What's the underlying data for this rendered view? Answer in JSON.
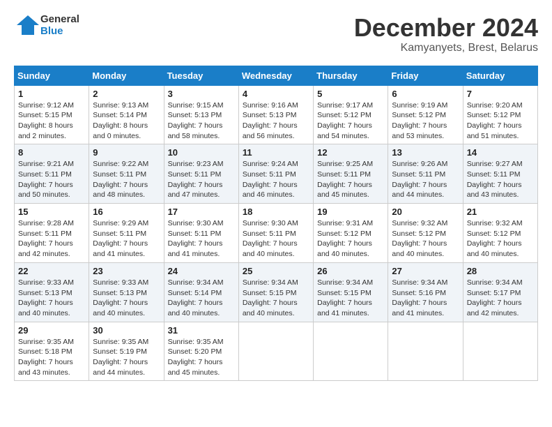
{
  "logo": {
    "text_general": "General",
    "text_blue": "Blue"
  },
  "title": {
    "month_year": "December 2024",
    "location": "Kamyanyets, Brest, Belarus"
  },
  "days_of_week": [
    "Sunday",
    "Monday",
    "Tuesday",
    "Wednesday",
    "Thursday",
    "Friday",
    "Saturday"
  ],
  "weeks": [
    [
      {
        "day": "1",
        "sunrise": "9:12 AM",
        "sunset": "5:15 PM",
        "daylight": "8 hours and 2 minutes."
      },
      {
        "day": "2",
        "sunrise": "9:13 AM",
        "sunset": "5:14 PM",
        "daylight": "8 hours and 0 minutes."
      },
      {
        "day": "3",
        "sunrise": "9:15 AM",
        "sunset": "5:13 PM",
        "daylight": "7 hours and 58 minutes."
      },
      {
        "day": "4",
        "sunrise": "9:16 AM",
        "sunset": "5:13 PM",
        "daylight": "7 hours and 56 minutes."
      },
      {
        "day": "5",
        "sunrise": "9:17 AM",
        "sunset": "5:12 PM",
        "daylight": "7 hours and 54 minutes."
      },
      {
        "day": "6",
        "sunrise": "9:19 AM",
        "sunset": "5:12 PM",
        "daylight": "7 hours and 53 minutes."
      },
      {
        "day": "7",
        "sunrise": "9:20 AM",
        "sunset": "5:12 PM",
        "daylight": "7 hours and 51 minutes."
      }
    ],
    [
      {
        "day": "8",
        "sunrise": "9:21 AM",
        "sunset": "5:11 PM",
        "daylight": "7 hours and 50 minutes."
      },
      {
        "day": "9",
        "sunrise": "9:22 AM",
        "sunset": "5:11 PM",
        "daylight": "7 hours and 48 minutes."
      },
      {
        "day": "10",
        "sunrise": "9:23 AM",
        "sunset": "5:11 PM",
        "daylight": "7 hours and 47 minutes."
      },
      {
        "day": "11",
        "sunrise": "9:24 AM",
        "sunset": "5:11 PM",
        "daylight": "7 hours and 46 minutes."
      },
      {
        "day": "12",
        "sunrise": "9:25 AM",
        "sunset": "5:11 PM",
        "daylight": "7 hours and 45 minutes."
      },
      {
        "day": "13",
        "sunrise": "9:26 AM",
        "sunset": "5:11 PM",
        "daylight": "7 hours and 44 minutes."
      },
      {
        "day": "14",
        "sunrise": "9:27 AM",
        "sunset": "5:11 PM",
        "daylight": "7 hours and 43 minutes."
      }
    ],
    [
      {
        "day": "15",
        "sunrise": "9:28 AM",
        "sunset": "5:11 PM",
        "daylight": "7 hours and 42 minutes."
      },
      {
        "day": "16",
        "sunrise": "9:29 AM",
        "sunset": "5:11 PM",
        "daylight": "7 hours and 41 minutes."
      },
      {
        "day": "17",
        "sunrise": "9:30 AM",
        "sunset": "5:11 PM",
        "daylight": "7 hours and 41 minutes."
      },
      {
        "day": "18",
        "sunrise": "9:30 AM",
        "sunset": "5:11 PM",
        "daylight": "7 hours and 40 minutes."
      },
      {
        "day": "19",
        "sunrise": "9:31 AM",
        "sunset": "5:12 PM",
        "daylight": "7 hours and 40 minutes."
      },
      {
        "day": "20",
        "sunrise": "9:32 AM",
        "sunset": "5:12 PM",
        "daylight": "7 hours and 40 minutes."
      },
      {
        "day": "21",
        "sunrise": "9:32 AM",
        "sunset": "5:12 PM",
        "daylight": "7 hours and 40 minutes."
      }
    ],
    [
      {
        "day": "22",
        "sunrise": "9:33 AM",
        "sunset": "5:13 PM",
        "daylight": "7 hours and 40 minutes."
      },
      {
        "day": "23",
        "sunrise": "9:33 AM",
        "sunset": "5:13 PM",
        "daylight": "7 hours and 40 minutes."
      },
      {
        "day": "24",
        "sunrise": "9:34 AM",
        "sunset": "5:14 PM",
        "daylight": "7 hours and 40 minutes."
      },
      {
        "day": "25",
        "sunrise": "9:34 AM",
        "sunset": "5:15 PM",
        "daylight": "7 hours and 40 minutes."
      },
      {
        "day": "26",
        "sunrise": "9:34 AM",
        "sunset": "5:15 PM",
        "daylight": "7 hours and 41 minutes."
      },
      {
        "day": "27",
        "sunrise": "9:34 AM",
        "sunset": "5:16 PM",
        "daylight": "7 hours and 41 minutes."
      },
      {
        "day": "28",
        "sunrise": "9:34 AM",
        "sunset": "5:17 PM",
        "daylight": "7 hours and 42 minutes."
      }
    ],
    [
      {
        "day": "29",
        "sunrise": "9:35 AM",
        "sunset": "5:18 PM",
        "daylight": "7 hours and 43 minutes."
      },
      {
        "day": "30",
        "sunrise": "9:35 AM",
        "sunset": "5:19 PM",
        "daylight": "7 hours and 44 minutes."
      },
      {
        "day": "31",
        "sunrise": "9:35 AM",
        "sunset": "5:20 PM",
        "daylight": "7 hours and 45 minutes."
      },
      null,
      null,
      null,
      null
    ]
  ]
}
